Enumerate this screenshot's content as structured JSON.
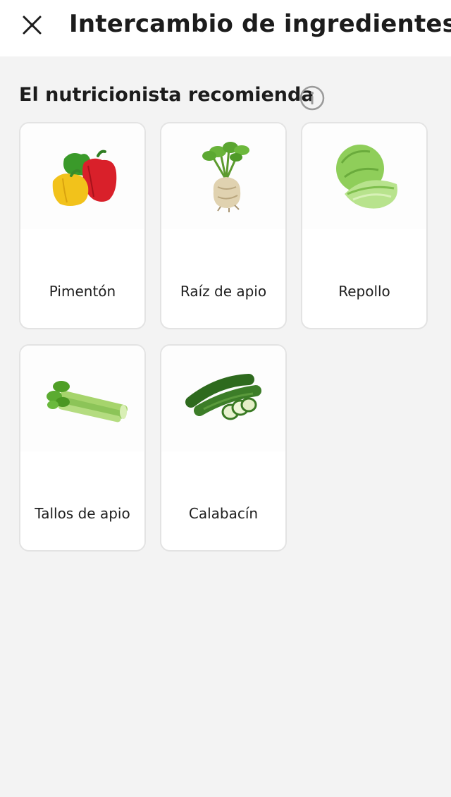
{
  "header": {
    "title": "Intercambio de ingredientes",
    "close_icon": "close-icon"
  },
  "section": {
    "title": "El nutricionista recomienda",
    "info_icon": "info-icon"
  },
  "ingredients": [
    {
      "label": "Pimentón",
      "image": "bell-peppers"
    },
    {
      "label": "Raíz de apio",
      "image": "celery-root"
    },
    {
      "label": "Repollo",
      "image": "cabbage"
    },
    {
      "label": "Tallos de apio",
      "image": "celery-stalks"
    },
    {
      "label": "Calabacín",
      "image": "zucchini"
    }
  ],
  "colors": {
    "background": "#f3f3f3",
    "card": "#ffffff",
    "card_border": "#e3e3e3",
    "text": "#1c1c1c"
  }
}
